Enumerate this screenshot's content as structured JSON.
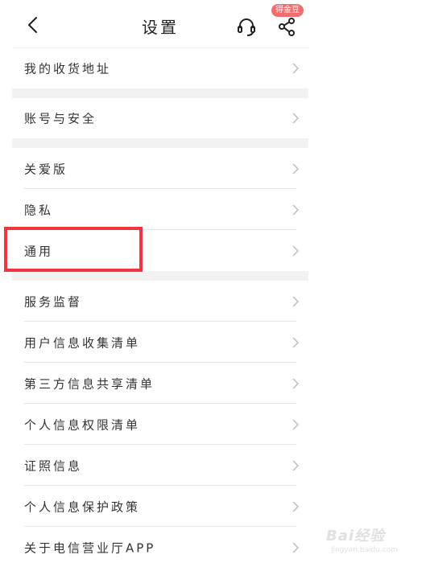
{
  "header": {
    "title": "设置",
    "badge": "得金豆",
    "icons": {
      "back": "chevron-left-icon",
      "service": "headset-icon",
      "share": "share-icon"
    }
  },
  "groups": [
    {
      "items": [
        {
          "label": "我的收货地址"
        }
      ]
    },
    {
      "items": [
        {
          "label": "账号与安全"
        }
      ]
    },
    {
      "items": [
        {
          "label": "关爱版"
        },
        {
          "label": "隐私"
        },
        {
          "label": "通用"
        }
      ]
    },
    {
      "items": [
        {
          "label": "服务监督"
        },
        {
          "label": "用户信息收集清单"
        },
        {
          "label": "第三方信息共享清单"
        },
        {
          "label": "个人信息权限清单"
        },
        {
          "label": "证照信息"
        },
        {
          "label": "个人信息保护政策"
        },
        {
          "label": "关于电信营业厅APP"
        }
      ]
    }
  ],
  "watermark": {
    "logo": "Bai经验",
    "url": "jingyan.baidu.com"
  },
  "colors": {
    "highlight": "#f2343c",
    "badge": "#f26d6d",
    "divider": "#e6e6e6",
    "gap": "#f2f2f2"
  }
}
